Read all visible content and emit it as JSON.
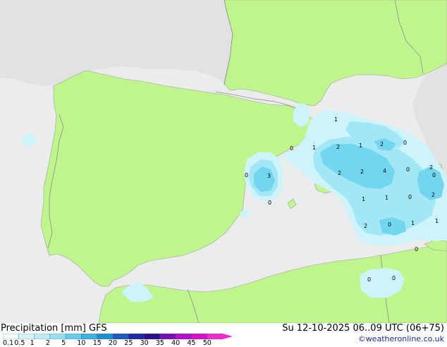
{
  "map": {
    "colors": {
      "sea": "#ececec",
      "land_shown": "#c0f58e",
      "land_outside": "#e2e2e2",
      "precip_light": "#cdf3fb",
      "precip_medium": "#a3e7f6",
      "precip_strong": "#72d6ee"
    },
    "point_labels": [
      "1",
      "1",
      "2",
      "1",
      "2",
      "0",
      "0",
      "3",
      "0",
      "0",
      "1",
      "2",
      "2",
      "4",
      "0",
      "2",
      "1",
      "0",
      "2",
      "2",
      "0",
      "1",
      "1",
      "0",
      "0",
      "0",
      "0"
    ]
  },
  "footer": {
    "title": "Precipitation [mm]  GFS",
    "valid_time": "Su 12-10-2025 06..09 UTC (06+75)",
    "credit": "©weatheronline.co.uk"
  },
  "legend": {
    "ticks": [
      "0.1",
      "0.5",
      "1",
      "2",
      "5",
      "10",
      "15",
      "20",
      "25",
      "30",
      "35",
      "40",
      "45",
      "50"
    ],
    "colors": [
      "#f2fcfe",
      "#d6f5fb",
      "#b7edf8",
      "#8fe0f2",
      "#63cdeb",
      "#38b2e0",
      "#1f8fd4",
      "#1a5cbf",
      "#1a2aa8",
      "#2a0f8f",
      "#7a0fb8",
      "#b40fcf",
      "#d90fc9",
      "#f02ad1"
    ]
  }
}
